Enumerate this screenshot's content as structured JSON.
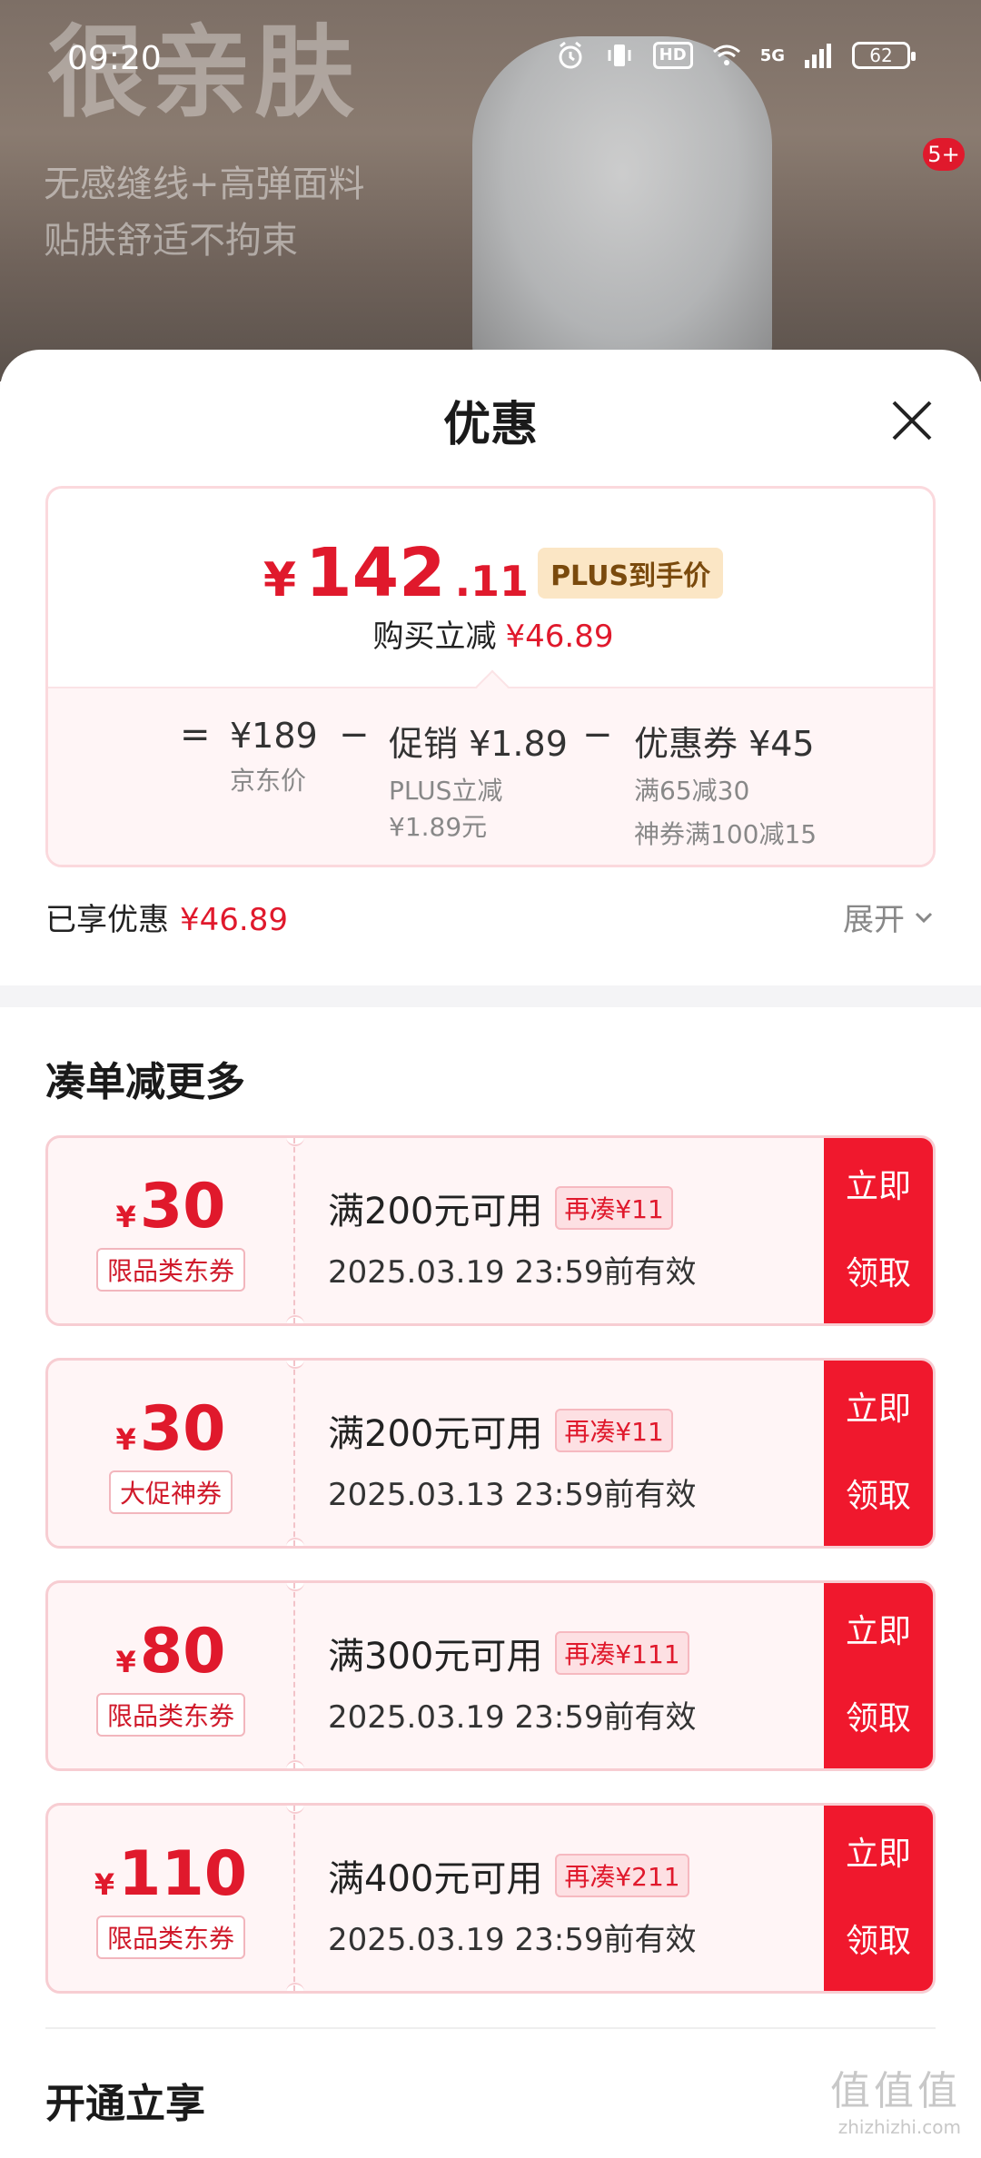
{
  "status_bar": {
    "time": "09:20",
    "battery": "62",
    "network": "5G",
    "hd": "HD"
  },
  "background": {
    "headline": "很亲肤",
    "sub1": "无感缝线+高弹面料",
    "sub2": "贴肤舒适不拘束",
    "badge": "5+"
  },
  "sheet": {
    "title": "优惠",
    "price": {
      "symbol": "¥",
      "integer": "142",
      "decimal": ".11",
      "plus_tag": "PLUS到手价",
      "save_label": "购买立减",
      "save_amount": "¥46.89"
    },
    "breakdown": {
      "eq": "=",
      "minus1": "−",
      "minus2": "−",
      "jd_price": "¥189",
      "jd_price_label": "京东价",
      "promo": "促销 ¥1.89",
      "promo_sub1": "PLUS立减",
      "promo_sub2": "¥1.89元",
      "coupon": "优惠券 ¥45",
      "coupon_sub1": "满65减30",
      "coupon_sub2": "神券满100减15"
    },
    "enjoyed_label": "已享优惠",
    "enjoyed_amount": "¥46.89",
    "expand_label": "展开"
  },
  "section_more": {
    "title": "凑单减更多"
  },
  "coupons": [
    {
      "symbol": "¥",
      "amount": "30",
      "type": "限品类东券",
      "condition": "满200元可用",
      "more": "再凑¥11",
      "valid": "2025.03.19 23:59前有效",
      "btn1": "立即",
      "btn2": "领取"
    },
    {
      "symbol": "¥",
      "amount": "30",
      "type": "大促神券",
      "condition": "满200元可用",
      "more": "再凑¥11",
      "valid": "2025.03.13 23:59前有效",
      "btn1": "立即",
      "btn2": "领取"
    },
    {
      "symbol": "¥",
      "amount": "80",
      "type": "限品类东券",
      "condition": "满300元可用",
      "more": "再凑¥111",
      "valid": "2025.03.19 23:59前有效",
      "btn1": "立即",
      "btn2": "领取"
    },
    {
      "symbol": "¥",
      "amount": "110",
      "type": "限品类东券",
      "condition": "满400元可用",
      "more": "再凑¥211",
      "valid": "2025.03.19 23:59前有效",
      "btn1": "立即",
      "btn2": "领取"
    }
  ],
  "section_open": {
    "title": "开通立享"
  },
  "watermark": {
    "line1": "值值值",
    "line2": "zhizhizhi.com"
  },
  "colors": {
    "accent": "#e0192c",
    "button": "#f0182d",
    "plus_tag_bg": "#fbe6c5"
  }
}
